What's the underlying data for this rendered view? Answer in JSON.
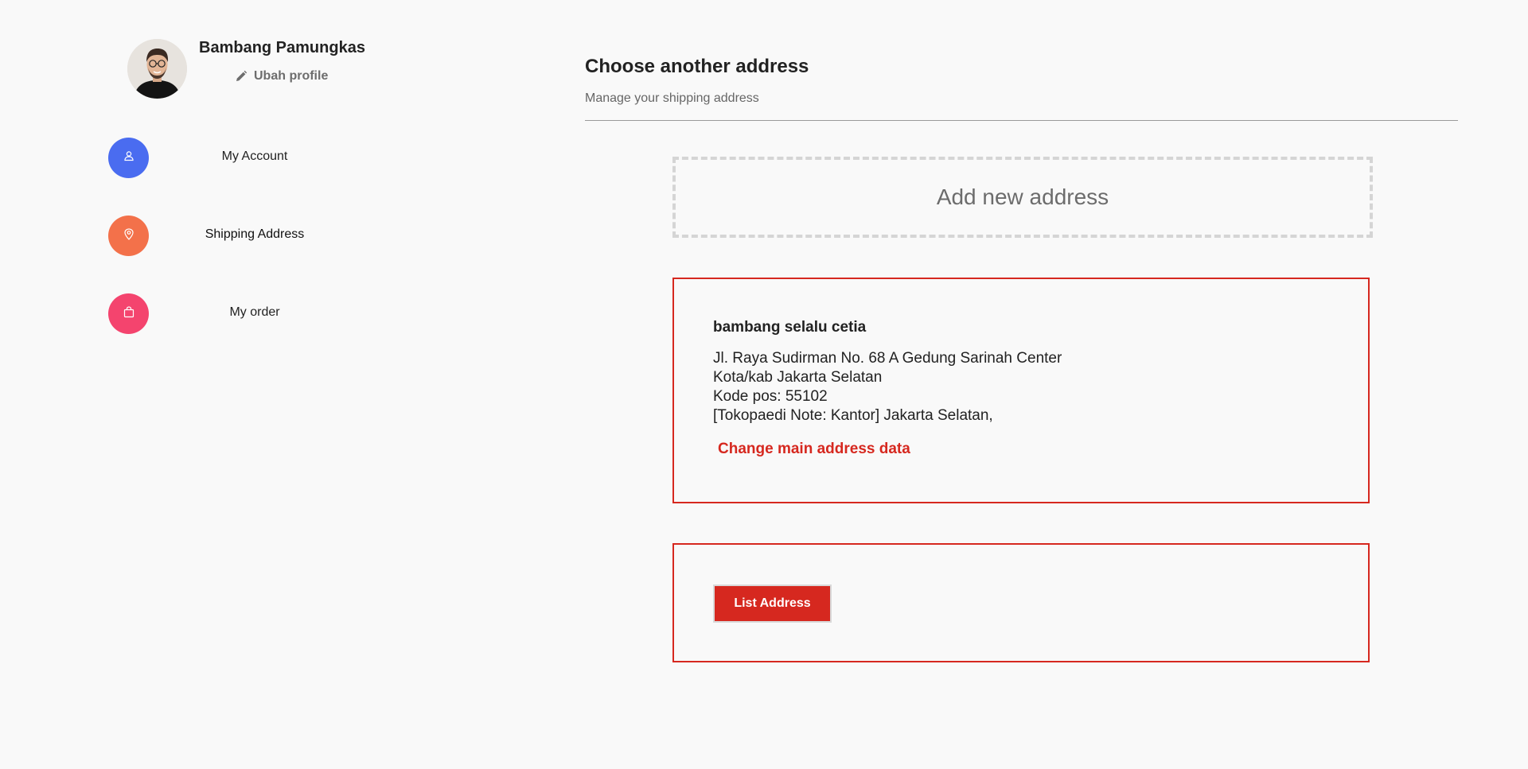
{
  "profile": {
    "name": "Bambang Pamungkas",
    "edit_label": "Ubah profile"
  },
  "sidebar": {
    "items": [
      {
        "label": "My Account",
        "icon": "user-icon",
        "color": "#4a6cf0",
        "active": false
      },
      {
        "label": "Shipping Address",
        "icon": "map-pin-icon",
        "color": "#f3714a",
        "active": true
      },
      {
        "label": "My order",
        "icon": "shopping-bag-icon",
        "color": "#f4446e",
        "active": false
      }
    ]
  },
  "main": {
    "title": "Choose another address",
    "subtitle": "Manage your shipping address",
    "add_address_label": "Add new address",
    "address": {
      "recipient": "bambang selalu cetia",
      "street": "Jl. Raya Sudirman No. 68 A Gedung Sarinah Center",
      "city": "Kota/kab Jakarta Selatan",
      "postal_code": "Kode pos: 55102",
      "note": "[Tokopaedi Note: Kantor] Jakarta Selatan,",
      "change_link": "Change main address data"
    },
    "list_button": "List Address"
  },
  "colors": {
    "accent": "#d6281f",
    "background": "#f9f9f9",
    "dashed_border": "#d5d5d5"
  }
}
